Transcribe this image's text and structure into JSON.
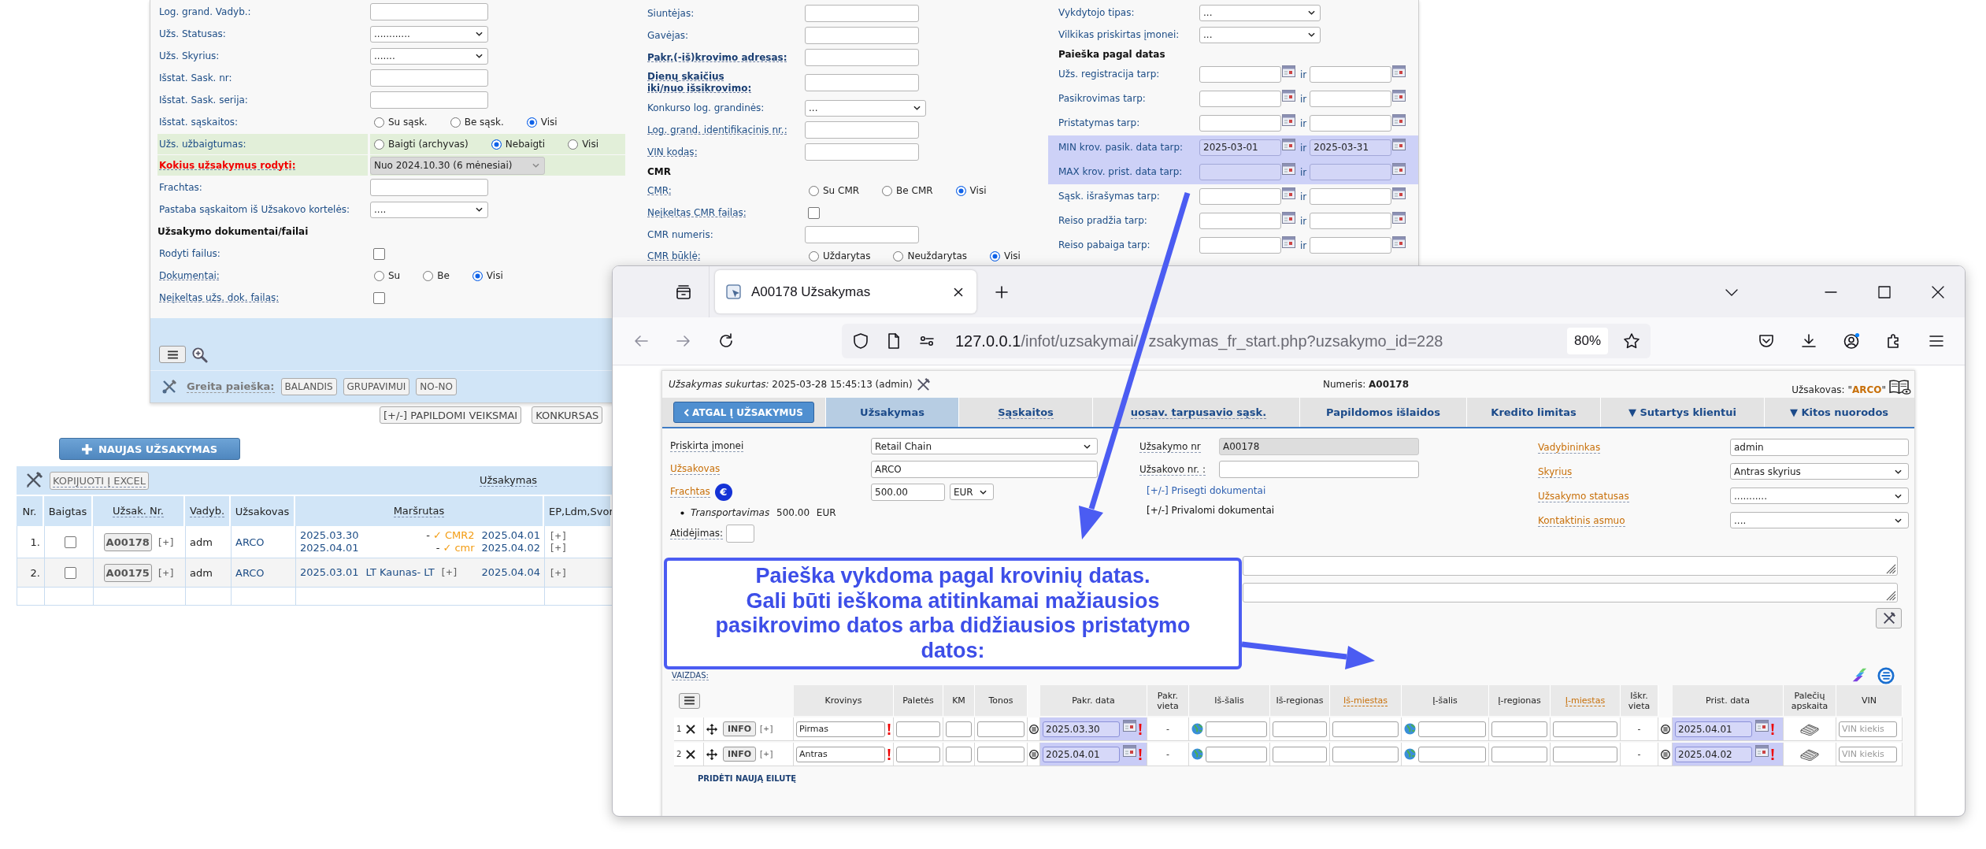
{
  "search_form": {
    "left_fields": [
      {
        "kind": "input",
        "label": "Log. grand. Vadyb.:",
        "bold": false,
        "alert": false,
        "underlined": false,
        "highlighted": false
      },
      {
        "kind": "select",
        "label": "Užs. Statusas:",
        "bold": false,
        "alert": false,
        "underlined": false,
        "highlighted": false,
        "value": "............",
        "disabled": false
      },
      {
        "kind": "select",
        "label": "Užs. Skyrius:",
        "bold": false,
        "alert": false,
        "underlined": false,
        "highlighted": false,
        "value": ".......",
        "disabled": false
      },
      {
        "kind": "input",
        "label": "Išstat. Sask. nr:",
        "bold": false,
        "alert": false,
        "underlined": false,
        "highlighted": false
      },
      {
        "kind": "input",
        "label": "Išstat. Sask. serija:",
        "bold": false,
        "alert": false,
        "underlined": false,
        "highlighted": false
      },
      {
        "kind": "radio",
        "label": "Išstat. sąskaitos:",
        "bold": false,
        "alert": false,
        "underlined": false,
        "highlighted": false,
        "options": [
          {
            "label": "Su sąsk.",
            "selected": false
          },
          {
            "label": "Be sąsk.",
            "selected": false
          },
          {
            "label": "Visi",
            "selected": true
          }
        ]
      },
      {
        "kind": "radio",
        "label": "Užs. užbaigtumas:",
        "bold": false,
        "alert": false,
        "underlined": false,
        "highlighted": true,
        "options": [
          {
            "label": "Baigti (archyvas)",
            "selected": false
          },
          {
            "label": "Nebaigti",
            "selected": true
          },
          {
            "label": "Visi",
            "selected": false
          }
        ]
      },
      {
        "kind": "select",
        "label": "Kokius užsakymus rodyti:",
        "bold": true,
        "alert": true,
        "underlined": true,
        "highlighted": true,
        "value": "Nuo 2024.10.30 (6 mėnesiai)",
        "disabled": true
      },
      {
        "kind": "input",
        "label": "Frachtas:",
        "bold": false,
        "alert": false,
        "underlined": false,
        "highlighted": false
      },
      {
        "kind": "select",
        "label": "Pastaba sąskaitom iš Užsakovo kortelės:",
        "bold": false,
        "alert": false,
        "underlined": false,
        "highlighted": false,
        "value": "....",
        "disabled": false
      },
      {
        "kind": "section",
        "label": "Užsakymo dokumentai/failai"
      },
      {
        "kind": "checkbox",
        "label": "Rodyti failus:",
        "bold": false,
        "alert": false,
        "underlined": false,
        "highlighted": false,
        "checked": false
      },
      {
        "kind": "radio",
        "label": "Dokumentai:",
        "bold": false,
        "alert": false,
        "underlined": true,
        "highlighted": false,
        "options": [
          {
            "label": "Su",
            "selected": false
          },
          {
            "label": "Be",
            "selected": false
          },
          {
            "label": "Visi",
            "selected": true
          }
        ]
      },
      {
        "kind": "checkbox",
        "label": "Neįkeltas užs. dok. failas:",
        "bold": false,
        "alert": false,
        "underlined": true,
        "highlighted": false,
        "checked": false
      }
    ],
    "middle_fields": [
      {
        "kind": "input",
        "label": "Siuntėjas:",
        "bold": false,
        "alert": false,
        "underlined": false,
        "highlighted": false
      },
      {
        "kind": "input",
        "label": "Gavėjas:",
        "bold": false,
        "alert": false,
        "underlined": false,
        "highlighted": false
      },
      {
        "kind": "input",
        "label": "Pakr.(-iš)krovimo adresas:",
        "bold": true,
        "alert": false,
        "underlined": true,
        "highlighted": false
      },
      {
        "kind": "input",
        "label": "Dienų skaičius\niki/nuo išsikrovimo:",
        "bold": true,
        "alert": false,
        "underlined": true,
        "highlighted": false
      },
      {
        "kind": "select",
        "label": "Konkurso log. grandinės:",
        "bold": false,
        "alert": false,
        "underlined": false,
        "highlighted": false,
        "value": "...",
        "disabled": false
      },
      {
        "kind": "input",
        "label": "Log. grand. identifikacinis nr.:",
        "bold": false,
        "alert": false,
        "underlined": true,
        "highlighted": false
      },
      {
        "kind": "input",
        "label": "VIN kodas:",
        "bold": false,
        "alert": false,
        "underlined": true,
        "highlighted": false
      },
      {
        "kind": "section",
        "label": "CMR"
      },
      {
        "kind": "radio",
        "label": "CMR:",
        "bold": false,
        "alert": false,
        "underlined": true,
        "highlighted": false,
        "options": [
          {
            "label": "Su CMR",
            "selected": false
          },
          {
            "label": "Be CMR",
            "selected": false
          },
          {
            "label": "Visi",
            "selected": true
          }
        ]
      },
      {
        "kind": "checkbox",
        "label": "Neįkeltas CMR failas:",
        "bold": false,
        "alert": false,
        "underlined": true,
        "highlighted": false,
        "checked": false
      },
      {
        "kind": "input",
        "label": "CMR numeris:",
        "bold": false,
        "alert": false,
        "underlined": false,
        "highlighted": false
      },
      {
        "kind": "radio",
        "label": "CMR būklė:",
        "bold": false,
        "alert": false,
        "underlined": true,
        "highlighted": false,
        "options": [
          {
            "label": "Uždarytas",
            "selected": false
          },
          {
            "label": "Neuždarytas",
            "selected": false
          },
          {
            "label": "Visi",
            "selected": true
          }
        ]
      }
    ],
    "right_fields": [
      {
        "kind": "select",
        "label": "Vykdytojo tipas:",
        "bold": false,
        "alert": false,
        "underlined": false,
        "highlighted": false,
        "value": "...",
        "disabled": false
      },
      {
        "kind": "select",
        "label": "Vilkikas priskirtas įmonei:",
        "bold": false,
        "alert": false,
        "underlined": false,
        "highlighted": false,
        "value": "...",
        "disabled": false
      },
      {
        "kind": "section",
        "label": "Paieška pagal datas"
      },
      {
        "kind": "date_range",
        "label": "Užs. registracija tarp:",
        "bold": false,
        "alert": false,
        "underlined": false,
        "highlighted": false,
        "joiner": "ir"
      },
      {
        "kind": "date_range",
        "label": "Pasikrovimas tarp:",
        "bold": false,
        "alert": false,
        "underlined": false,
        "highlighted": false,
        "joiner": "ir"
      },
      {
        "kind": "date_range",
        "label": "Pristatymas tarp:",
        "bold": false,
        "alert": false,
        "underlined": false,
        "highlighted": false,
        "joiner": "ir"
      },
      {
        "kind": "date_range",
        "label": "MIN krov. pasik. data tarp:",
        "bold": false,
        "alert": false,
        "underlined": false,
        "highlighted": true,
        "from": "2025-03-01",
        "joiner": "ir",
        "to": "2025-03-31"
      },
      {
        "kind": "date_range",
        "label": "MAX krov. prist. data tarp:",
        "bold": false,
        "alert": false,
        "underlined": false,
        "highlighted": true,
        "joiner": "ir"
      },
      {
        "kind": "date_range",
        "label": "Sąsk. išrašymas tarp:",
        "bold": false,
        "alert": false,
        "underlined": false,
        "highlighted": false,
        "joiner": "ir"
      },
      {
        "kind": "date_range",
        "label": "Reiso pradžia tarp:",
        "bold": false,
        "alert": false,
        "underlined": false,
        "highlighted": false,
        "joiner": "ir"
      },
      {
        "kind": "date_range",
        "label": "Reiso pabaiga tarp:",
        "bold": false,
        "alert": false,
        "underlined": false,
        "highlighted": false,
        "joiner": "ir"
      }
    ],
    "quick_search": {
      "label": "Greita paieška:",
      "buttons": [
        "BALANDIS",
        "GRUPAVIMUI",
        "NO-NO"
      ]
    }
  },
  "page_actions": [
    "[+/-] PAPILDOMI VEIKSMAI",
    "KONKURSAS"
  ],
  "new_order_button": "NAUJAS UŽSAKYMAS",
  "orders_table": {
    "copy_button": "KOPIJUOTI Į EXCEL",
    "group_heading": "Užsakymas",
    "columns": [
      {
        "label": "Nr.",
        "underlined": false
      },
      {
        "label": "Baigtas",
        "underlined": false
      },
      {
        "label": "Užsak. Nr.",
        "underlined": true
      },
      {
        "label": "Vadyb.",
        "underlined": true
      },
      {
        "label": "Užsakovas",
        "underlined": false
      },
      {
        "label": "Maršrutas",
        "underlined": true
      },
      {
        "label": "EP,Ldm,Svor",
        "underlined": false
      }
    ],
    "rows": [
      {
        "nr": "1.",
        "done": false,
        "order_no": "A00178",
        "expand": "[+]",
        "manager": "adm",
        "customer": "ARCO",
        "legs": [
          {
            "kind": "document",
            "from": "2025.03.30",
            "dash": "-",
            "document": "✓ CMR2",
            "to": "2025.04.01"
          },
          {
            "kind": "document",
            "from": "2025.04.01",
            "dash": "-",
            "document": "✓ cmr",
            "to": "2025.04.02"
          }
        ],
        "extras": [
          "[+]",
          "[+]"
        ]
      },
      {
        "nr": "2.",
        "done": false,
        "order_no": "A00175",
        "expand": "[+]",
        "manager": "adm",
        "customer": "ARCO",
        "legs": [
          {
            "kind": "place",
            "from": "2025.03.01",
            "place": "LT Kaunas- LT",
            "expand": "[+]",
            "to": "2025.04.04"
          }
        ],
        "extras": [
          "[+]"
        ]
      }
    ]
  },
  "browser": {
    "tab": {
      "title": "A00178 Užsakymas",
      "selected": true
    },
    "url_host": "127.0.0.1",
    "url_path_parts": [
      "/infot/uzsakymai/",
      "zsakymas_fr_start.php?uzsakymo_id=228"
    ],
    "zoom": "80%",
    "page": {
      "created": "*Užsakymas sukurtas:* 2025-03-28 15:45:13 (admin)",
      "number": "Numeris: **A00178**",
      "customer": "Užsakovas: \"**ARCO**\"",
      "back_button": "ATGAL Į UŽSAKYMUS",
      "tabs": [
        {
          "label": "Užsakymas",
          "selected": true,
          "underlined": false
        },
        {
          "label": "Sąskaitos",
          "selected": false,
          "underlined": true
        },
        {
          "label": "uosav. tarpusavio sąsk.",
          "selected": false,
          "underlined": true
        },
        {
          "label": "Papildomos išlaidos",
          "selected": false,
          "underlined": false
        },
        {
          "label": "Kredito limitas",
          "selected": false,
          "underlined": false
        },
        {
          "label": "▼ Sutartys klientui",
          "selected": false,
          "underlined": false
        },
        {
          "label": "▼ Kitos nuorodos",
          "selected": false,
          "underlined": false
        }
      ],
      "left_fields": [
        {
          "kind": "select",
          "label": "Priskirta įmonei",
          "color": "#222222",
          "value": "Retail Chain"
        },
        {
          "kind": "input",
          "label": "Užsakovas",
          "color": "#c8700a",
          "value": "ARCO"
        },
        {
          "kind": "money",
          "label": "Frachtas",
          "color": "#c8700a",
          "currency_badge": "€",
          "value": "500.00",
          "currency": "EUR"
        }
      ],
      "freight_items": [
        {
          "line": "*Transportavimas* 500.00 EUR"
        }
      ],
      "delay_label": "Atidėjimas:",
      "middle_fields": [
        {
          "kind": "readonly",
          "label": "Užsakymo nr",
          "color": "#222222",
          "value": "A00178"
        },
        {
          "kind": "input",
          "label": "Užsakovo nr. :",
          "color": "#222222"
        }
      ],
      "document_links": [
        {
          "kind": "link",
          "label": "[+/-] Prisegti dokumentai"
        },
        {
          "kind": "toggle",
          "label": "[+/-] Privalomi dokumentai"
        }
      ],
      "right_fields": [
        {
          "kind": "input",
          "label": "Vadybininkas",
          "color": "#c8700a",
          "value": "admin"
        },
        {
          "kind": "select",
          "label": "Skyrius",
          "color": "#c8700a",
          "value": "Antras skyrius"
        },
        {
          "kind": "select",
          "label": "Užsakymo statusas",
          "color": "#c8700a",
          "value": "..........."
        },
        {
          "kind": "select",
          "label": "Kontaktinis asmuo",
          "color": "#c8700a",
          "value": "...."
        }
      ],
      "view_label": "VAIZDAS:",
      "cargo_table": {
        "columns": [
          {
            "label": "Krovinys",
            "underlined": false
          },
          {
            "label": "Paletės",
            "underlined": false
          },
          {
            "label": "KM",
            "underlined": false
          },
          {
            "label": "Tonos",
            "underlined": false
          },
          {
            "label": "Pakr. data",
            "underlined": false
          },
          {
            "label": "Pakr. vieta",
            "underlined": false
          },
          {
            "label": "Iš-šalis",
            "underlined": false
          },
          {
            "label": "Iš-regionas",
            "underlined": false
          },
          {
            "label": "Iš-miestas",
            "underlined": true
          },
          {
            "label": "Į-šalis",
            "underlined": false
          },
          {
            "label": "Į-regionas",
            "underlined": false
          },
          {
            "label": "Į-miestas",
            "underlined": true
          },
          {
            "label": "Iškr. vieta",
            "underlined": false
          },
          {
            "label": "Prist. data",
            "underlined": false
          },
          {
            "label": "Palečių apskaita",
            "underlined": false
          },
          {
            "label": "VIN",
            "underlined": false
          }
        ],
        "rows": [
          {
            "nr": "1",
            "info": "INFO",
            "expand": "[+]",
            "cargo": "Pirmas",
            "load_date": "2025.03.30",
            "load_place": "-",
            "unload_place": "-",
            "unload_date": "2025.04.01",
            "vin_placeholder": "VIN kiekis"
          },
          {
            "nr": "2",
            "info": "INFO",
            "expand": "[+]",
            "cargo": "Antras",
            "load_date": "2025.04.01",
            "load_place": "-",
            "unload_place": "-",
            "unload_date": "2025.04.02",
            "vin_placeholder": "VIN kiekis"
          }
        ],
        "add_row": "PRIDĖTI NAUJĄ EILUTĘ"
      }
    }
  },
  "annotation": {
    "text": "Paieška vykdoma pagal krovinių datas.\nGali būti ieškoma atitinkamai mažiausios\npasikrovimo datos arba didžiausios pristatymo\ndatos:"
  }
}
